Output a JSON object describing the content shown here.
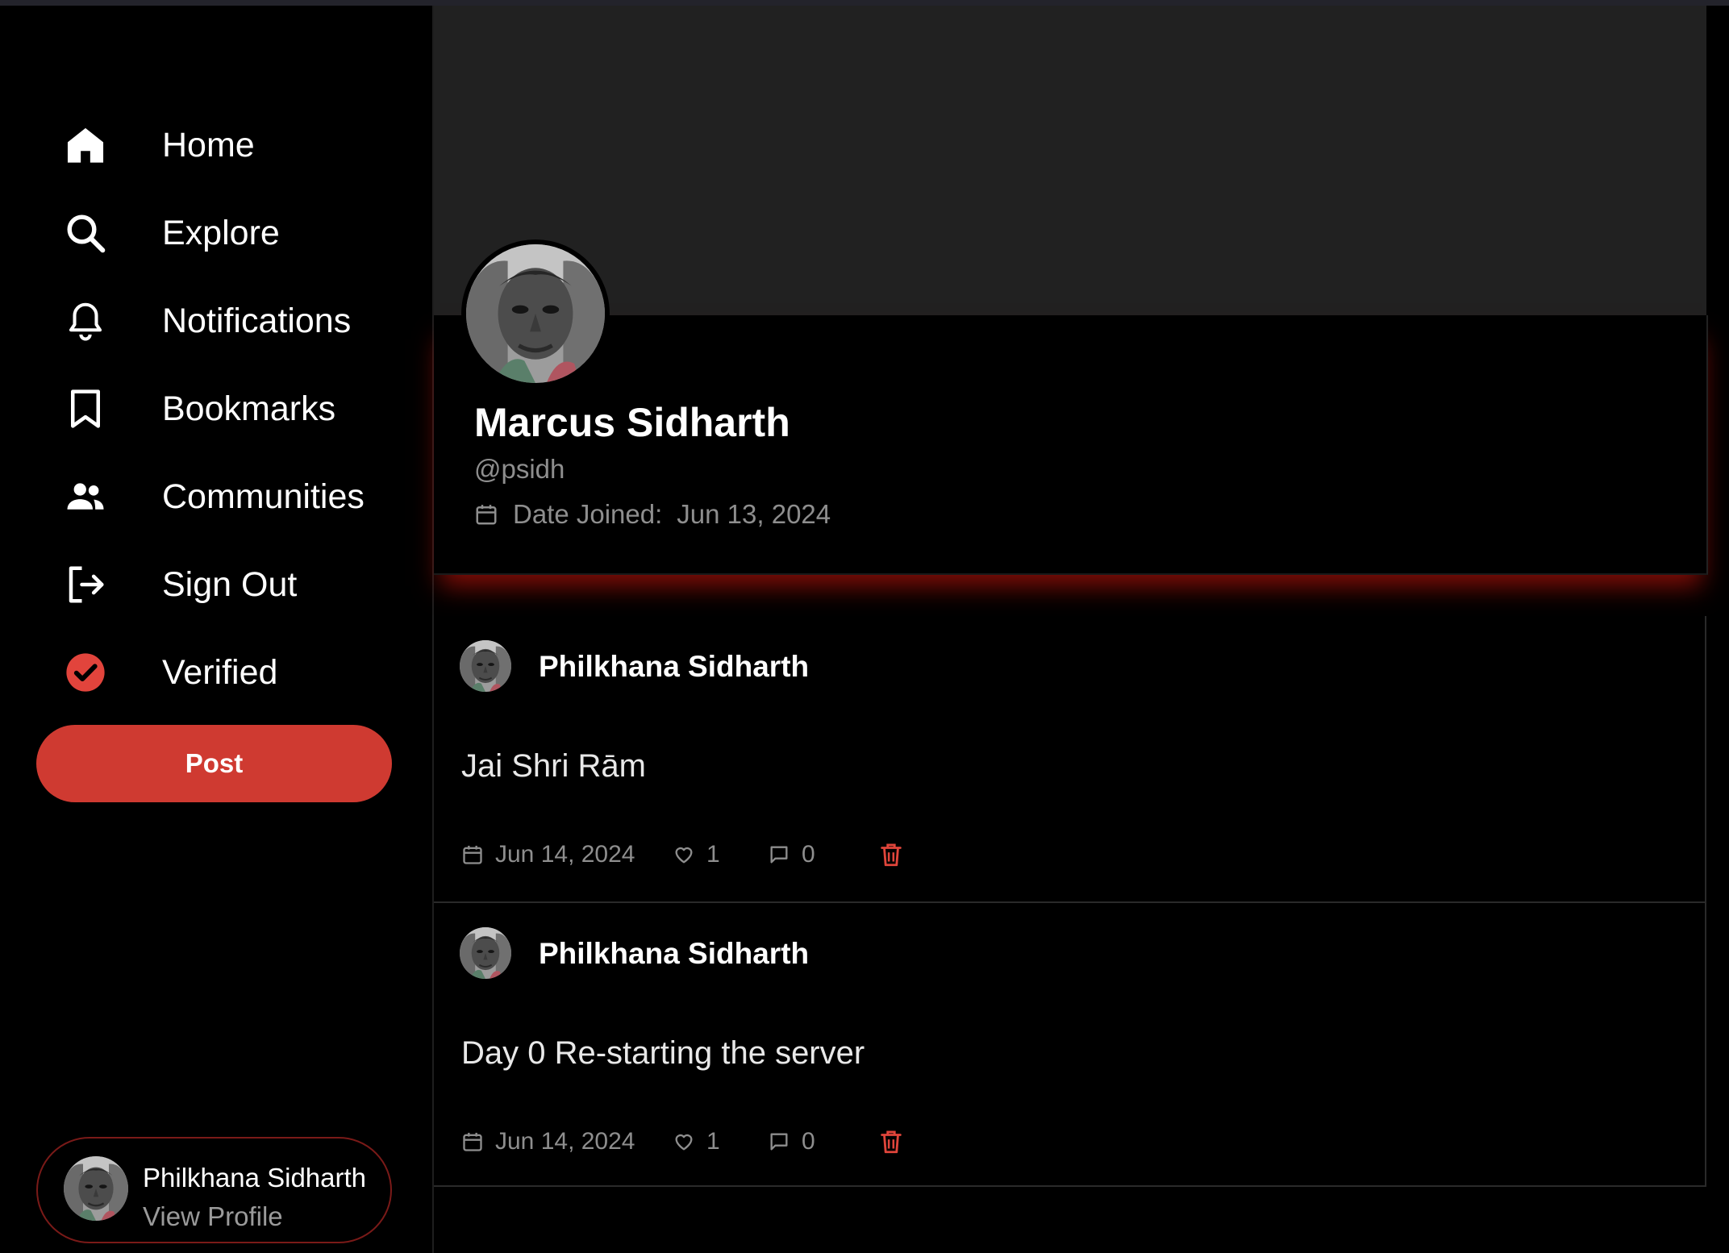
{
  "sidebar": {
    "items": [
      {
        "label": "Home",
        "icon": "home-icon"
      },
      {
        "label": "Explore",
        "icon": "search-icon"
      },
      {
        "label": "Notifications",
        "icon": "bell-icon"
      },
      {
        "label": "Bookmarks",
        "icon": "bookmark-icon"
      },
      {
        "label": "Communities",
        "icon": "users-icon"
      },
      {
        "label": "Sign Out",
        "icon": "sign-out-icon"
      },
      {
        "label": "Verified",
        "icon": "verified-check-icon"
      }
    ],
    "post_button": "Post",
    "profile": {
      "name": "Philkhana Sidharth",
      "link": "View Profile"
    }
  },
  "profile": {
    "name": "Marcus Sidharth",
    "handle": "@psidh",
    "joined_label": "Date Joined:",
    "joined_date": "Jun 13, 2024"
  },
  "posts": [
    {
      "author": "Philkhana Sidharth",
      "content": "Jai Shri Rām",
      "date": "Jun 14, 2024",
      "likes": "1",
      "comments": "0"
    },
    {
      "author": "Philkhana Sidharth",
      "content": "Day 0 Re-starting the server",
      "date": "Jun 14, 2024",
      "likes": "1",
      "comments": "0"
    }
  ],
  "colors": {
    "accent": "#cf3a31",
    "background": "#000000",
    "banner": "#212121",
    "muted_text": "#8e8e8e",
    "delete_icon": "#e0453b"
  }
}
